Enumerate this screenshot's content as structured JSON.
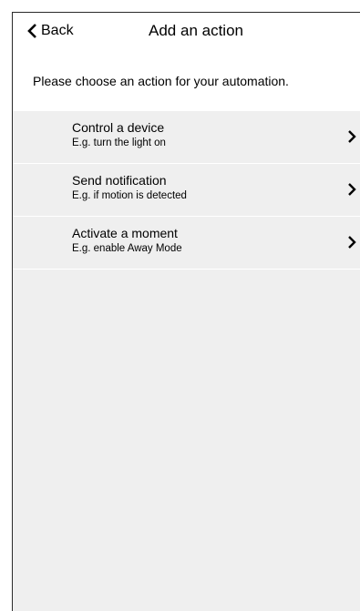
{
  "header": {
    "back_label": "Back",
    "title": "Add an action"
  },
  "subtitle": "Please choose an action for your automation.",
  "actions": [
    {
      "title": "Control a device",
      "description": "E.g. turn the light on"
    },
    {
      "title": "Send notification",
      "description": "E.g. if motion is detected"
    },
    {
      "title": "Activate a moment",
      "description": "E.g. enable Away Mode"
    }
  ],
  "icons": {
    "back": "chevron-left-icon",
    "item": "chevron-right-icon"
  },
  "colors": {
    "background": "#efefef",
    "header": "#ffffff",
    "text": "#000000"
  }
}
